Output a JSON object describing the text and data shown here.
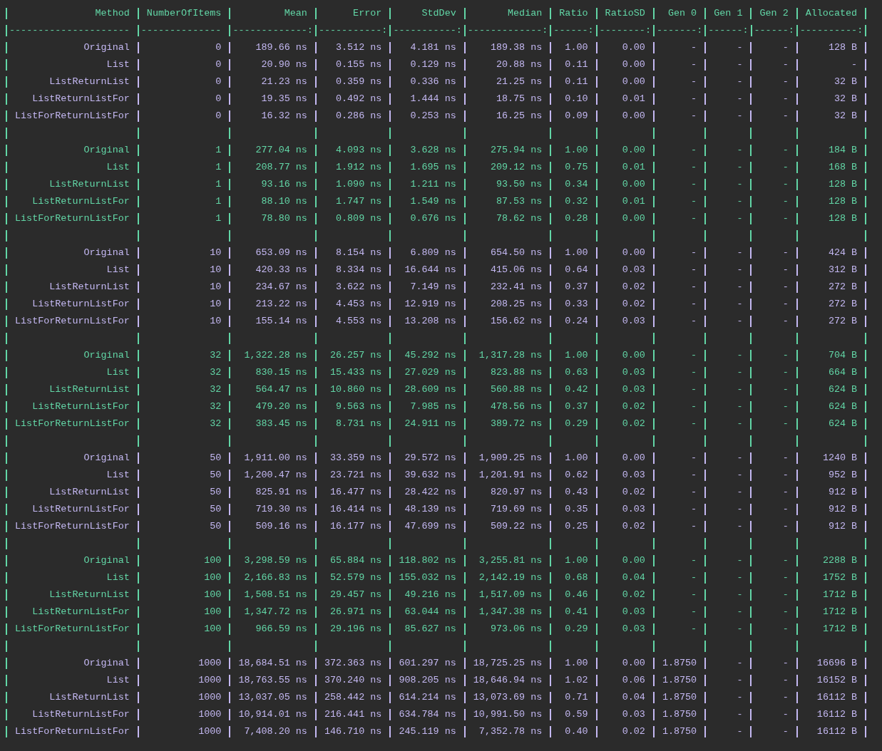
{
  "header": [
    "Method",
    "NumberOfItems",
    "Mean",
    "Error",
    "StdDev",
    "Median",
    "Ratio",
    "RatioSD",
    "Gen 0",
    "Gen 1",
    "Gen 2",
    "Allocated"
  ],
  "separator": [
    "---------------------",
    "--------------",
    "-------------:",
    "-----------:",
    "-----------:",
    "-------------:",
    "------:",
    "--------:",
    "-------:",
    "------:",
    "------:",
    "----------:"
  ],
  "groups": [
    {
      "color": "#c4b8f2",
      "rows": [
        [
          "Original",
          "0",
          "189.66 ns",
          "3.512 ns",
          "4.181 ns",
          "189.38 ns",
          "1.00",
          "0.00",
          "-",
          "-",
          "-",
          "128 B"
        ],
        [
          "List",
          "0",
          "20.90 ns",
          "0.155 ns",
          "0.129 ns",
          "20.88 ns",
          "0.11",
          "0.00",
          "-",
          "-",
          "-",
          "-"
        ],
        [
          "ListReturnList",
          "0",
          "21.23 ns",
          "0.359 ns",
          "0.336 ns",
          "21.25 ns",
          "0.11",
          "0.00",
          "-",
          "-",
          "-",
          "32 B"
        ],
        [
          "ListReturnListFor",
          "0",
          "19.35 ns",
          "0.492 ns",
          "1.444 ns",
          "18.75 ns",
          "0.10",
          "0.01",
          "-",
          "-",
          "-",
          "32 B"
        ],
        [
          "ListForReturnListFor",
          "0",
          "16.32 ns",
          "0.286 ns",
          "0.253 ns",
          "16.25 ns",
          "0.09",
          "0.00",
          "-",
          "-",
          "-",
          "32 B"
        ]
      ]
    },
    {
      "color": "#62d6a6",
      "rows": [
        [
          "Original",
          "1",
          "277.04 ns",
          "4.093 ns",
          "3.628 ns",
          "275.94 ns",
          "1.00",
          "0.00",
          "-",
          "-",
          "-",
          "184 B"
        ],
        [
          "List",
          "1",
          "208.77 ns",
          "1.912 ns",
          "1.695 ns",
          "209.12 ns",
          "0.75",
          "0.01",
          "-",
          "-",
          "-",
          "168 B"
        ],
        [
          "ListReturnList",
          "1",
          "93.16 ns",
          "1.090 ns",
          "1.211 ns",
          "93.50 ns",
          "0.34",
          "0.00",
          "-",
          "-",
          "-",
          "128 B"
        ],
        [
          "ListReturnListFor",
          "1",
          "88.10 ns",
          "1.747 ns",
          "1.549 ns",
          "87.53 ns",
          "0.32",
          "0.01",
          "-",
          "-",
          "-",
          "128 B"
        ],
        [
          "ListForReturnListFor",
          "1",
          "78.80 ns",
          "0.809 ns",
          "0.676 ns",
          "78.62 ns",
          "0.28",
          "0.00",
          "-",
          "-",
          "-",
          "128 B"
        ]
      ]
    },
    {
      "color": "#c4b8f2",
      "rows": [
        [
          "Original",
          "10",
          "653.09 ns",
          "8.154 ns",
          "6.809 ns",
          "654.50 ns",
          "1.00",
          "0.00",
          "-",
          "-",
          "-",
          "424 B"
        ],
        [
          "List",
          "10",
          "420.33 ns",
          "8.334 ns",
          "16.644 ns",
          "415.06 ns",
          "0.64",
          "0.03",
          "-",
          "-",
          "-",
          "312 B"
        ],
        [
          "ListReturnList",
          "10",
          "234.67 ns",
          "3.622 ns",
          "7.149 ns",
          "232.41 ns",
          "0.37",
          "0.02",
          "-",
          "-",
          "-",
          "272 B"
        ],
        [
          "ListReturnListFor",
          "10",
          "213.22 ns",
          "4.453 ns",
          "12.919 ns",
          "208.25 ns",
          "0.33",
          "0.02",
          "-",
          "-",
          "-",
          "272 B"
        ],
        [
          "ListForReturnListFor",
          "10",
          "155.14 ns",
          "4.553 ns",
          "13.208 ns",
          "156.62 ns",
          "0.24",
          "0.03",
          "-",
          "-",
          "-",
          "272 B"
        ]
      ]
    },
    {
      "color": "#62d6a6",
      "rows": [
        [
          "Original",
          "32",
          "1,322.28 ns",
          "26.257 ns",
          "45.292 ns",
          "1,317.28 ns",
          "1.00",
          "0.00",
          "-",
          "-",
          "-",
          "704 B"
        ],
        [
          "List",
          "32",
          "830.15 ns",
          "15.433 ns",
          "27.029 ns",
          "823.88 ns",
          "0.63",
          "0.03",
          "-",
          "-",
          "-",
          "664 B"
        ],
        [
          "ListReturnList",
          "32",
          "564.47 ns",
          "10.860 ns",
          "28.609 ns",
          "560.88 ns",
          "0.42",
          "0.03",
          "-",
          "-",
          "-",
          "624 B"
        ],
        [
          "ListReturnListFor",
          "32",
          "479.20 ns",
          "9.563 ns",
          "7.985 ns",
          "478.56 ns",
          "0.37",
          "0.02",
          "-",
          "-",
          "-",
          "624 B"
        ],
        [
          "ListForReturnListFor",
          "32",
          "383.45 ns",
          "8.731 ns",
          "24.911 ns",
          "389.72 ns",
          "0.29",
          "0.02",
          "-",
          "-",
          "-",
          "624 B"
        ]
      ]
    },
    {
      "color": "#c4b8f2",
      "rows": [
        [
          "Original",
          "50",
          "1,911.00 ns",
          "33.359 ns",
          "29.572 ns",
          "1,909.25 ns",
          "1.00",
          "0.00",
          "-",
          "-",
          "-",
          "1240 B"
        ],
        [
          "List",
          "50",
          "1,200.47 ns",
          "23.721 ns",
          "39.632 ns",
          "1,201.91 ns",
          "0.62",
          "0.03",
          "-",
          "-",
          "-",
          "952 B"
        ],
        [
          "ListReturnList",
          "50",
          "825.91 ns",
          "16.477 ns",
          "28.422 ns",
          "820.97 ns",
          "0.43",
          "0.02",
          "-",
          "-",
          "-",
          "912 B"
        ],
        [
          "ListReturnListFor",
          "50",
          "719.30 ns",
          "16.414 ns",
          "48.139 ns",
          "719.69 ns",
          "0.35",
          "0.03",
          "-",
          "-",
          "-",
          "912 B"
        ],
        [
          "ListForReturnListFor",
          "50",
          "509.16 ns",
          "16.177 ns",
          "47.699 ns",
          "509.22 ns",
          "0.25",
          "0.02",
          "-",
          "-",
          "-",
          "912 B"
        ]
      ]
    },
    {
      "color": "#62d6a6",
      "rows": [
        [
          "Original",
          "100",
          "3,298.59 ns",
          "65.884 ns",
          "118.802 ns",
          "3,255.81 ns",
          "1.00",
          "0.00",
          "-",
          "-",
          "-",
          "2288 B"
        ],
        [
          "List",
          "100",
          "2,166.83 ns",
          "52.579 ns",
          "155.032 ns",
          "2,142.19 ns",
          "0.68",
          "0.04",
          "-",
          "-",
          "-",
          "1752 B"
        ],
        [
          "ListReturnList",
          "100",
          "1,508.51 ns",
          "29.457 ns",
          "49.216 ns",
          "1,517.09 ns",
          "0.46",
          "0.02",
          "-",
          "-",
          "-",
          "1712 B"
        ],
        [
          "ListReturnListFor",
          "100",
          "1,347.72 ns",
          "26.971 ns",
          "63.044 ns",
          "1,347.38 ns",
          "0.41",
          "0.03",
          "-",
          "-",
          "-",
          "1712 B"
        ],
        [
          "ListForReturnListFor",
          "100",
          "966.59 ns",
          "29.196 ns",
          "85.627 ns",
          "973.06 ns",
          "0.29",
          "0.03",
          "-",
          "-",
          "-",
          "1712 B"
        ]
      ]
    },
    {
      "color": "#c4b8f2",
      "rows": [
        [
          "Original",
          "1000",
          "18,684.51 ns",
          "372.363 ns",
          "601.297 ns",
          "18,725.25 ns",
          "1.00",
          "0.00",
          "1.8750",
          "-",
          "-",
          "16696 B"
        ],
        [
          "List",
          "1000",
          "18,763.55 ns",
          "370.240 ns",
          "908.205 ns",
          "18,646.94 ns",
          "1.02",
          "0.06",
          "1.8750",
          "-",
          "-",
          "16152 B"
        ],
        [
          "ListReturnList",
          "1000",
          "13,037.05 ns",
          "258.442 ns",
          "614.214 ns",
          "13,073.69 ns",
          "0.71",
          "0.04",
          "1.8750",
          "-",
          "-",
          "16112 B"
        ],
        [
          "ListReturnListFor",
          "1000",
          "10,914.01 ns",
          "216.441 ns",
          "634.784 ns",
          "10,991.50 ns",
          "0.59",
          "0.03",
          "1.8750",
          "-",
          "-",
          "16112 B"
        ],
        [
          "ListForReturnListFor",
          "1000",
          "7,408.20 ns",
          "146.710 ns",
          "245.119 ns",
          "7,352.78 ns",
          "0.40",
          "0.02",
          "1.8750",
          "-",
          "-",
          "16112 B"
        ]
      ]
    }
  ]
}
